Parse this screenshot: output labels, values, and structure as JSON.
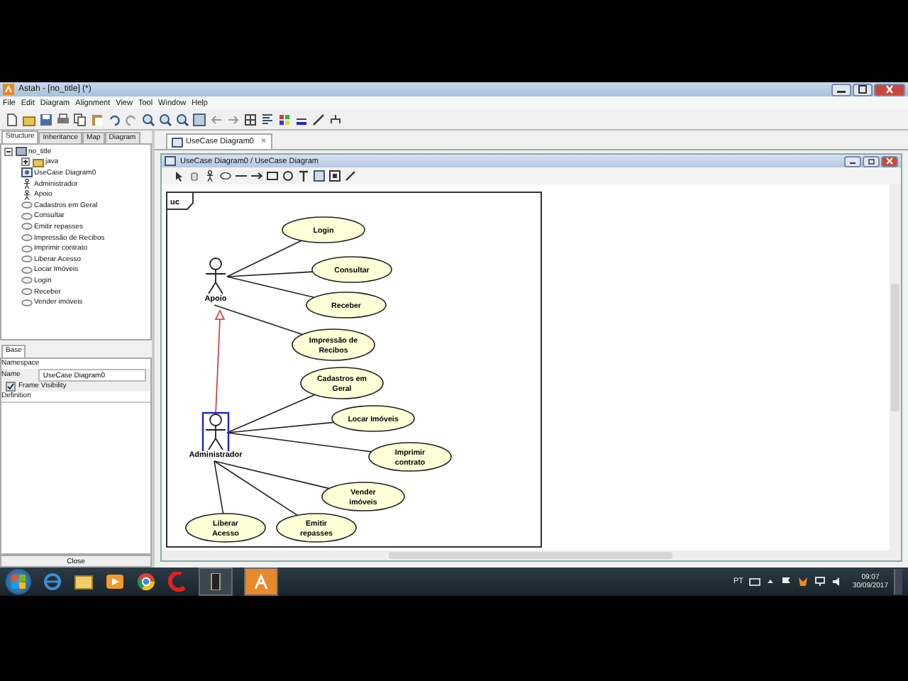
{
  "window": {
    "title": "Astah - [no_title] (*)"
  },
  "menu": [
    "File",
    "Edit",
    "Diagram",
    "Alignment",
    "View",
    "Tool",
    "Window",
    "Help"
  ],
  "left_tabs": [
    {
      "label": "Structure",
      "selected": true
    },
    {
      "label": "Inheritance",
      "selected": false
    },
    {
      "label": "Map",
      "selected": false
    },
    {
      "label": "Diagram",
      "selected": false
    }
  ],
  "tree": [
    {
      "label": "no_title",
      "kind": "project",
      "expanded": true,
      "children": [
        {
          "label": "java",
          "kind": "package",
          "expanded": false
        },
        {
          "label": "UseCase Diagram0",
          "kind": "diagram"
        },
        {
          "label": "Administrador",
          "kind": "actor"
        },
        {
          "label": "Apoio",
          "kind": "actor"
        },
        {
          "label": "Cadastros em Geral",
          "kind": "usecase"
        },
        {
          "label": "Consultar",
          "kind": "usecase"
        },
        {
          "label": "Emitir repasses",
          "kind": "usecase"
        },
        {
          "label": "Impressão de Recibos",
          "kind": "usecase"
        },
        {
          "label": "Imprimir contrato",
          "kind": "usecase"
        },
        {
          "label": "Liberar Acesso",
          "kind": "usecase"
        },
        {
          "label": "Locar Imóveis",
          "kind": "usecase"
        },
        {
          "label": "Login",
          "kind": "usecase"
        },
        {
          "label": "Receber",
          "kind": "usecase"
        },
        {
          "label": "Vender imóveis",
          "kind": "usecase"
        }
      ]
    }
  ],
  "properties": {
    "tab": "Base",
    "namespace_label": "Namespace",
    "name_label": "Name",
    "name_value": "UseCase Diagram0",
    "frame_visibility": {
      "label": "Frame Visibility",
      "checked": true
    },
    "definition_label": "Definition",
    "close_button": "Close"
  },
  "diagram_tab": {
    "label": "UseCase Diagram0",
    "close": "×"
  },
  "diagram_window": {
    "title": "UseCase Diagram0 / UseCase Diagram"
  },
  "diagram": {
    "frame_label": "uc",
    "actors": [
      {
        "name": "Apoio",
        "selected": false,
        "use_cases": [
          "Login",
          "Consultar",
          "Receber",
          "Impressão de Recibos"
        ]
      },
      {
        "name": "Administrador",
        "selected": true,
        "use_cases": [
          "Cadastros em Geral",
          "Locar Imóveis",
          "Imprimir contrato",
          "Vender imóveis",
          "Liberar Acesso",
          "Emitir repasses"
        ]
      }
    ]
  },
  "taskbar": {
    "language": "PT",
    "time": "09:07",
    "date": "30/09/2017"
  }
}
